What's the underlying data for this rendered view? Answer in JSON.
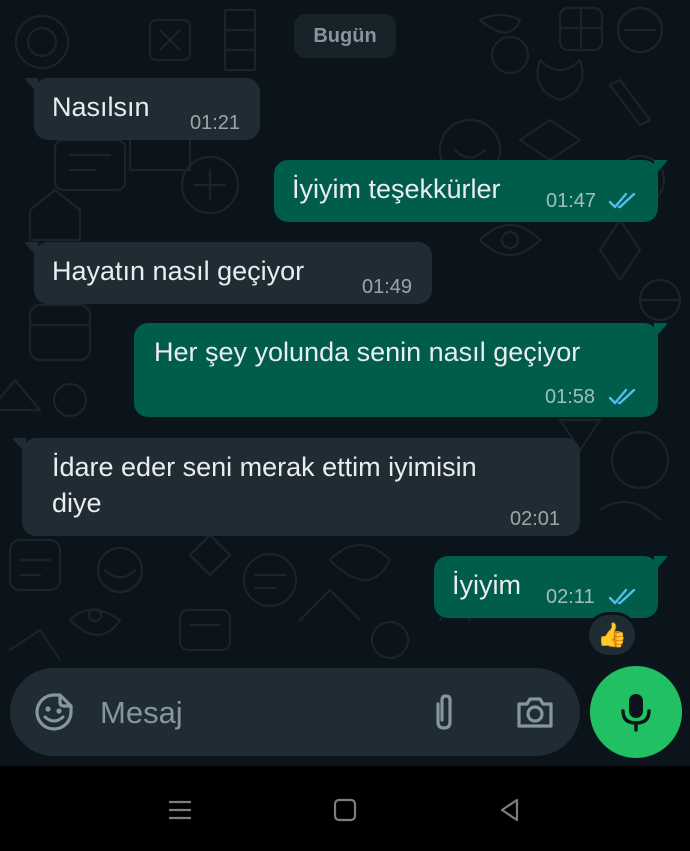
{
  "date_chip": "Bugün",
  "messages": [
    {
      "dir": "in",
      "text": "Nasılsın",
      "time": "01:21"
    },
    {
      "dir": "out",
      "text": "İyiyim teşekkürler",
      "time": "01:47",
      "status": "read"
    },
    {
      "dir": "in",
      "text": "Hayatın nasıl geçiyor",
      "time": "01:49"
    },
    {
      "dir": "out",
      "text": "Her şey yolunda senin nasıl geçiyor",
      "time": "01:58",
      "status": "read"
    },
    {
      "dir": "in",
      "text_line1": "İdare eder seni merak ettim iyimisin",
      "text_line2": "diye",
      "time": "02:01"
    },
    {
      "dir": "out",
      "text": "İyiyim",
      "time": "02:11",
      "status": "read",
      "reaction": "👍"
    }
  ],
  "composer": {
    "placeholder": "Mesaj",
    "icons": [
      "sticker-icon",
      "attach-icon",
      "camera-icon",
      "microphone-icon"
    ]
  },
  "navbar": {
    "icons": [
      "menu-icon",
      "home-icon",
      "back-icon"
    ]
  },
  "colors": {
    "background": "#0b141a",
    "incoming_bubble": "#202c33",
    "outgoing_bubble": "#005c4b",
    "read_ticks": "#53bdeb",
    "accent_green": "#21c063"
  }
}
